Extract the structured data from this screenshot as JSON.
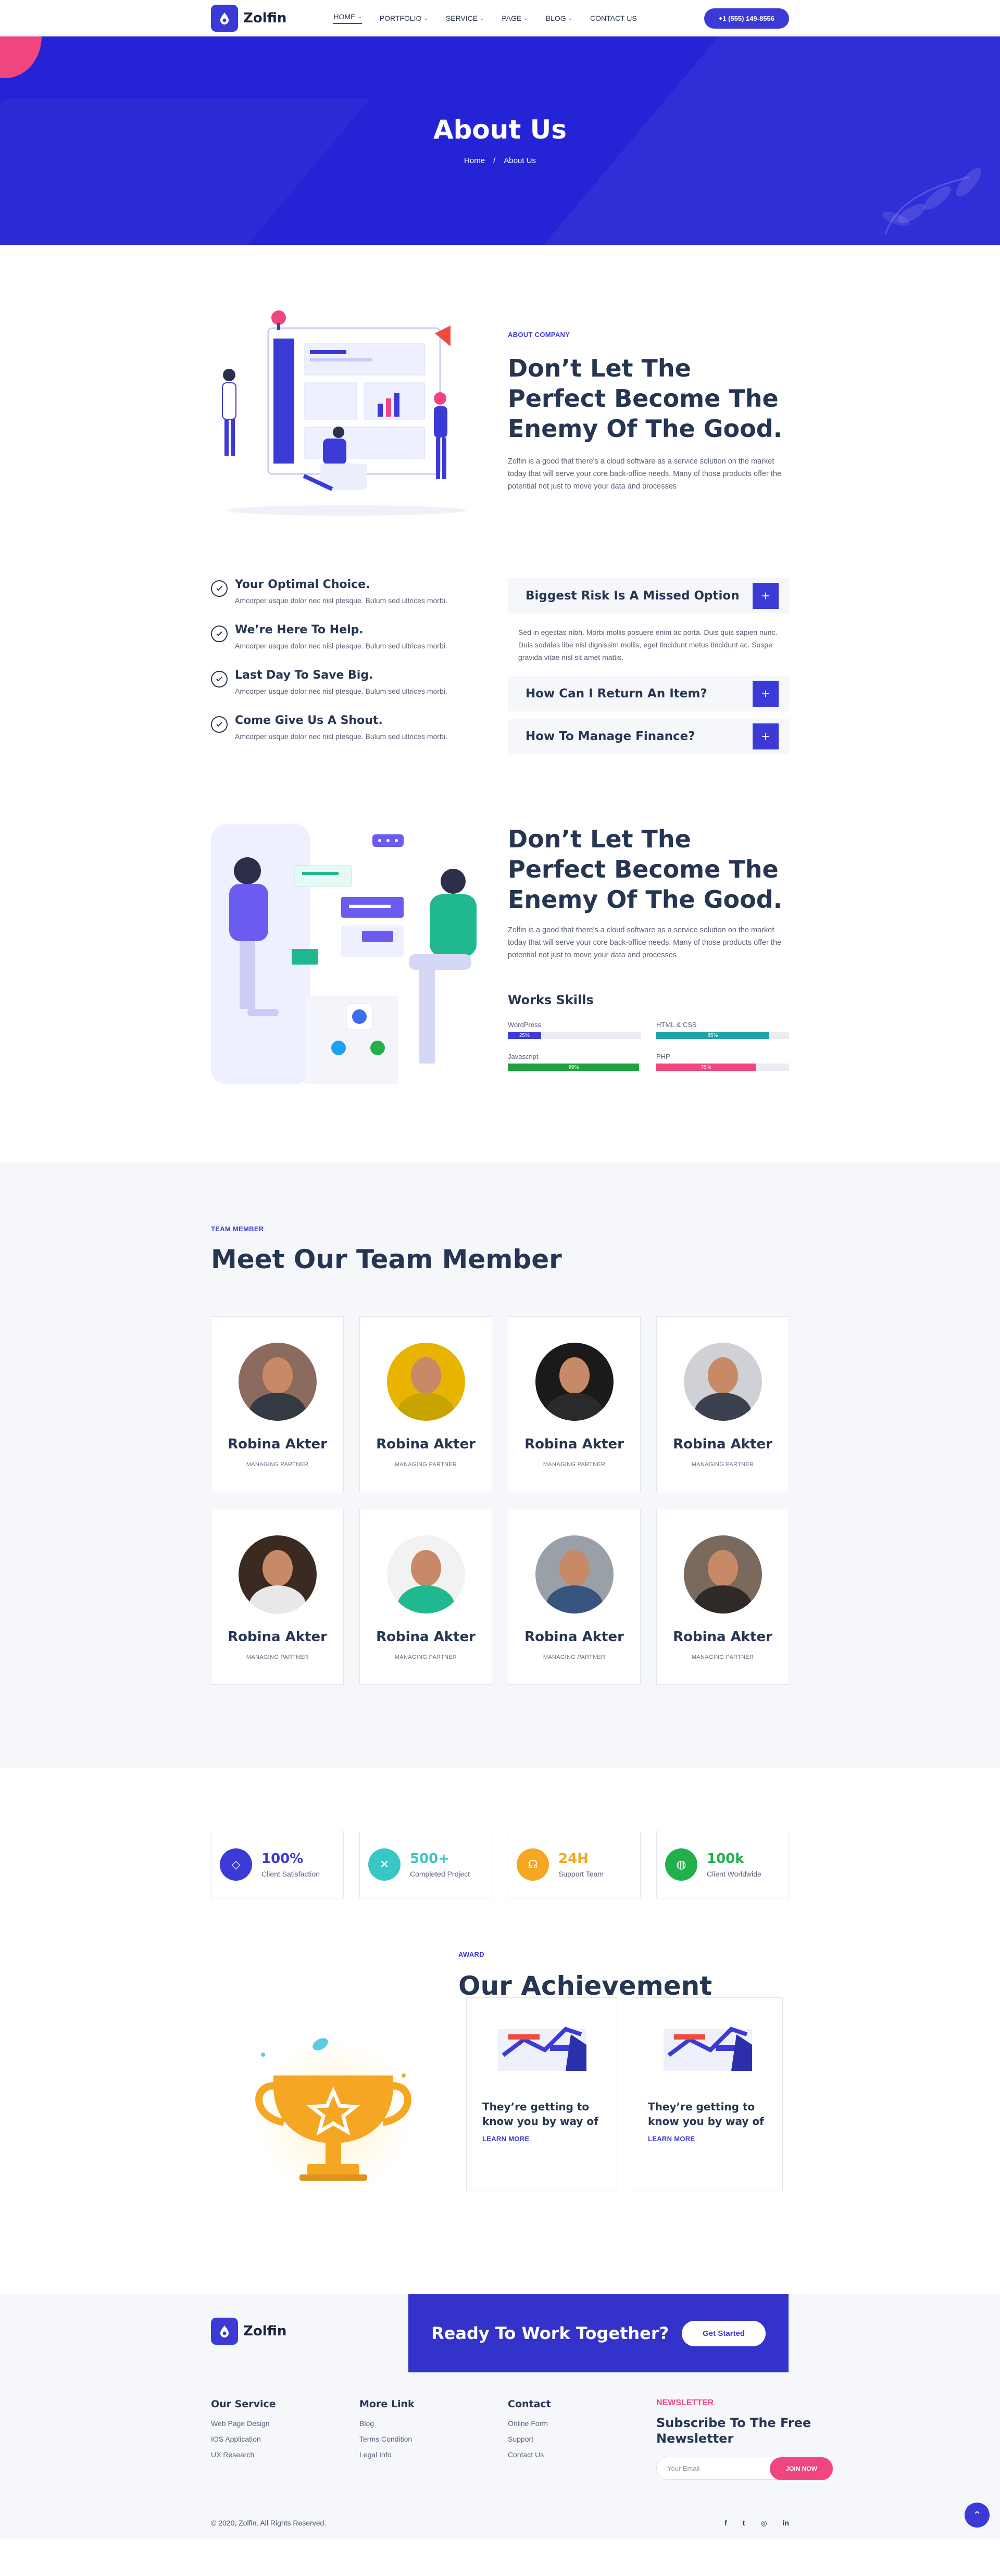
{
  "brand": {
    "name": "Zolfin"
  },
  "nav": {
    "items": [
      {
        "label": "HOME",
        "active": true
      },
      {
        "label": "PORTFOLIO",
        "active": false
      },
      {
        "label": "SERVICE",
        "active": false
      },
      {
        "label": "PAGE",
        "active": false
      },
      {
        "label": "BLOG",
        "active": false
      },
      {
        "label": "CONTACT US",
        "active": false
      }
    ],
    "phone": "+1 (555) 149-8556"
  },
  "hero": {
    "title": "About Us",
    "crumb_home": "Home",
    "crumb_sep": "/",
    "crumb_current": "About Us"
  },
  "about": {
    "eyebrow": "ABOUT COMPANY",
    "title": "Don’t Let The Perfect Become The Enemy Of The Good.",
    "text": "Zolfin is a good that there's a cloud software as a service solution on the market today that will serve your core back-office needs. Many of those products offer the potential not just to move your data and processes"
  },
  "features": [
    {
      "title": "Your Optimal Choice.",
      "text": "Amcorper usque dolor nec nisl ptesque. Bulum sed ultrices morbi."
    },
    {
      "title": "We’re Here To Help.",
      "text": "Amcorper usque dolor nec nisl ptesque. Bulum sed ultrices morbi."
    },
    {
      "title": "Last Day To Save Big.",
      "text": "Amcorper usque dolor nec nisl ptesque. Bulum sed ultrices morbi."
    },
    {
      "title": "Come Give Us A Shout.",
      "text": "Amcorper usque dolor nec nisl ptesque. Bulum sed ultrices morbi."
    }
  ],
  "accordion": {
    "open_title": "Biggest Risk Is A Missed Option",
    "open_text": "Sed in egestas nibh. Morbi mollis posuere enim ac porta. Duis quis sapien nunc. Duis sodales libe nisl dignissim mollis, eget tincidunt metus tincidunt ac. Suspe gravida vitae nisl sit amet mattis.",
    "items": [
      "How Can I Return An Item?",
      "How To Manage Finance?"
    ],
    "icon": "+"
  },
  "skills_section": {
    "title": "Don’t Let The Perfect Become The Enemy Of The Good.",
    "text": "Zolfin is a good that there's a cloud software as a service solution on the market today that will serve your core back-office needs. Many of those products offer the potential not just to move your data and processes",
    "skills_title": "Works Skills",
    "skills": [
      {
        "label": "WordPress",
        "value": 25,
        "text": "25%",
        "color": "#3c3ad6"
      },
      {
        "label": "HTML & CSS",
        "value": 85,
        "text": "85%",
        "color": "#1fa2a6"
      },
      {
        "label": "Javascript",
        "value": 99,
        "text": "99%",
        "color": "#21a03f"
      },
      {
        "label": "PHP",
        "value": 75,
        "text": "75%",
        "color": "#f0457f"
      }
    ]
  },
  "team": {
    "eyebrow": "TEAM MEMBER",
    "title": "Meet Our Team Member",
    "members": [
      {
        "name": "Robina Akter",
        "role": "MANAGING PARTNER",
        "bg": "#8a6b5e",
        "shirt": "#333a44"
      },
      {
        "name": "Robina Akter",
        "role": "MANAGING PARTNER",
        "bg": "#e8b400",
        "shirt": "#c7a300"
      },
      {
        "name": "Robina Akter",
        "role": "MANAGING PARTNER",
        "bg": "#1a1a1a",
        "shirt": "#2a2a2a"
      },
      {
        "name": "Robina Akter",
        "role": "MANAGING PARTNER",
        "bg": "#cfd1d6",
        "shirt": "#3c4150"
      },
      {
        "name": "Robina Akter",
        "role": "MANAGING PARTNER",
        "bg": "#3a2a22",
        "shirt": "#e8e8e8"
      },
      {
        "name": "Robina Akter",
        "role": "MANAGING PARTNER",
        "bg": "#f2f2f2",
        "shirt": "#1fb88f"
      },
      {
        "name": "Robina Akter",
        "role": "MANAGING PARTNER",
        "bg": "#9aa0a8",
        "shirt": "#37557e"
      },
      {
        "name": "Robina Akter",
        "role": "MANAGING PARTNER",
        "bg": "#7a6a5e",
        "shirt": "#2f2a28"
      }
    ]
  },
  "stats": [
    {
      "num": "100%",
      "cap": "Client Satisfaction",
      "color": "#3c3ad6",
      "icon": "diamond-icon",
      "glyph": "◇"
    },
    {
      "num": "500+",
      "cap": "Completed Project",
      "color": "#38c6c6",
      "icon": "tools-icon",
      "glyph": "✕"
    },
    {
      "num": "24H",
      "cap": "Support Team",
      "color": "#f5a623",
      "icon": "headset-icon",
      "glyph": "☊"
    },
    {
      "num": "100k",
      "cap": "Client Worldwide",
      "color": "#21b04b",
      "icon": "globe-icon",
      "glyph": "◍"
    }
  ],
  "achievement": {
    "eyebrow": "AWARD",
    "title": "Our Achievement",
    "cards": [
      {
        "title": "They’re getting to know you by way of",
        "link": "LEARN MORE"
      },
      {
        "title": "They’re getting to know you by way of",
        "link": "LEARN MORE"
      }
    ]
  },
  "cta": {
    "title": "Ready To Work Together?",
    "button": "Get Started"
  },
  "footer": {
    "cols": [
      {
        "title": "Our Service",
        "links": [
          "Web Page Design",
          "IOS Application",
          "UX Research"
        ]
      },
      {
        "title": "More Link",
        "links": [
          "Blog",
          "Terms Condition",
          "Legal Info"
        ]
      },
      {
        "title": "Contact",
        "links": [
          "Online Form",
          "Support",
          "Contact Us"
        ]
      }
    ],
    "newsletter_label": "NEWSLETTER",
    "newsletter_title": "Subscribe To The Free Newsletter",
    "email_placeholder": "Your Email",
    "join": "JOIN NOW",
    "copyright": "© 2020, Zolfin. All Rights Reserved.",
    "socials": [
      "f",
      "t",
      "◎",
      "in"
    ]
  }
}
